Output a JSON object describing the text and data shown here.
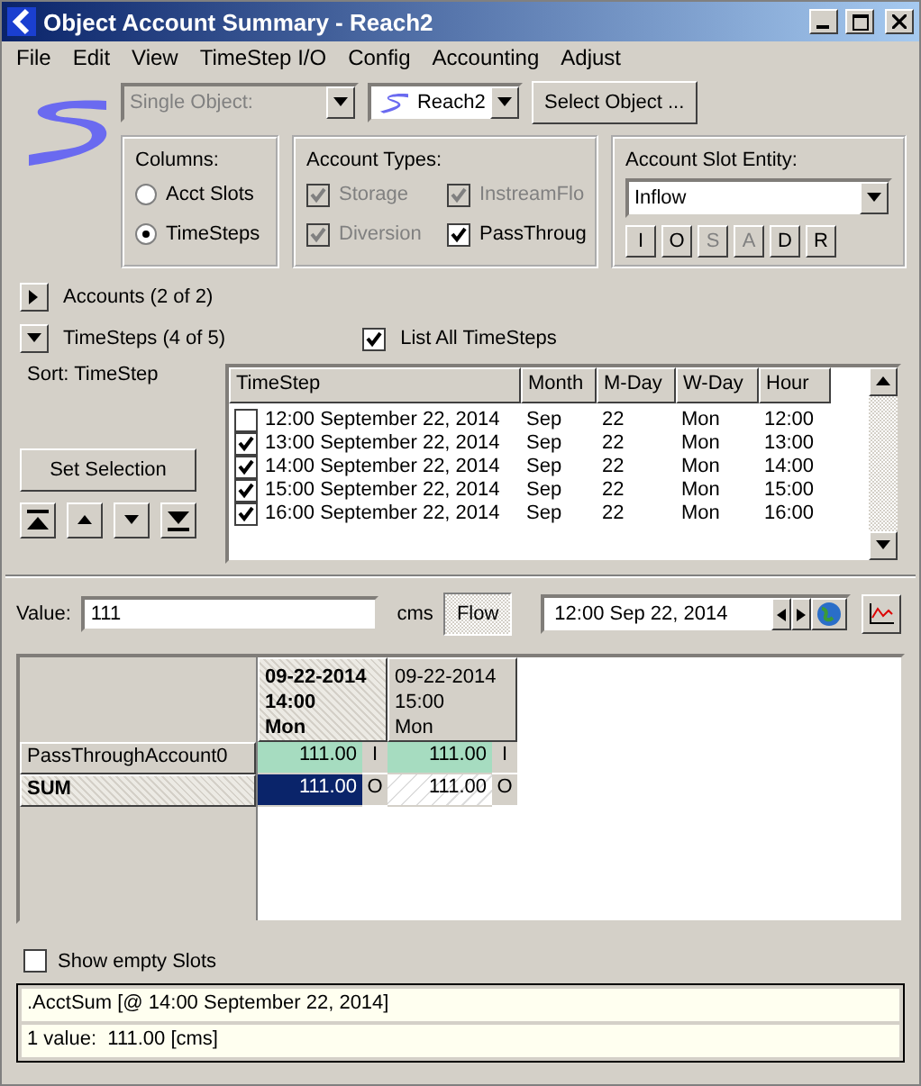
{
  "window": {
    "title": "Object Account Summary - Reach2"
  },
  "menu": [
    "File",
    "Edit",
    "View",
    "TimeStep I/O",
    "Config",
    "Accounting",
    "Adjust"
  ],
  "object_bar": {
    "mode": {
      "value": "Single Object:",
      "disabled": true
    },
    "object": "Reach2",
    "select_button": "Select Object ..."
  },
  "columns_group": {
    "title": "Columns:",
    "options": [
      {
        "label": "Acct Slots",
        "selected": false
      },
      {
        "label": "TimeSteps",
        "selected": true
      }
    ]
  },
  "account_types": {
    "title": "Account Types:",
    "items": [
      {
        "label": "Storage",
        "checked": true,
        "disabled": true
      },
      {
        "label": "InstreamFlo",
        "checked": true,
        "disabled": true
      },
      {
        "label": "Diversion",
        "checked": true,
        "disabled": true
      },
      {
        "label": "PassThroug",
        "checked": true,
        "disabled": false
      }
    ]
  },
  "slot_entity": {
    "title": "Account Slot Entity:",
    "value": "Inflow",
    "buttons": [
      {
        "label": "I",
        "disabled": false
      },
      {
        "label": "O",
        "disabled": false
      },
      {
        "label": "S",
        "disabled": true
      },
      {
        "label": "A",
        "disabled": true
      },
      {
        "label": "D",
        "disabled": false
      },
      {
        "label": "R",
        "disabled": false
      }
    ]
  },
  "accounts_toggle": {
    "label": "Accounts (2 of 2)",
    "expanded": false
  },
  "timesteps_toggle": {
    "label": "TimeSteps (4 of 5)",
    "expanded": true
  },
  "list_all": {
    "label": "List All TimeSteps",
    "checked": true
  },
  "sort_label": "Sort: TimeStep",
  "set_selection_button": "Set Selection",
  "timestep_table": {
    "columns": [
      "TimeStep",
      "Month",
      "M-Day",
      "W-Day",
      "Hour"
    ],
    "rows": [
      {
        "checked": false,
        "cells": [
          "12:00 September 22, 2014",
          "Sep",
          "22",
          "Mon",
          "12:00"
        ]
      },
      {
        "checked": true,
        "cells": [
          "13:00 September 22, 2014",
          "Sep",
          "22",
          "Mon",
          "13:00"
        ]
      },
      {
        "checked": true,
        "cells": [
          "14:00 September 22, 2014",
          "Sep",
          "22",
          "Mon",
          "14:00"
        ]
      },
      {
        "checked": true,
        "cells": [
          "15:00 September 22, 2014",
          "Sep",
          "22",
          "Mon",
          "15:00"
        ]
      },
      {
        "checked": true,
        "cells": [
          "16:00 September 22, 2014",
          "Sep",
          "22",
          "Mon",
          "16:00"
        ]
      }
    ]
  },
  "value_bar": {
    "label": "Value:",
    "value": "111",
    "unit": "cms",
    "flow_button": "Flow",
    "date": "12:00 Sep 22, 2014"
  },
  "grid": {
    "columns": [
      {
        "lines": [
          "09-22-2014",
          "14:00",
          "Mon"
        ],
        "selected": true
      },
      {
        "lines": [
          "09-22-2014",
          "15:00",
          "Mon"
        ],
        "selected": false
      }
    ],
    "rows": [
      {
        "label": "PassThroughAccount0",
        "kind": "account",
        "cells": [
          {
            "value": "111.00",
            "flag": "I",
            "selected": false
          },
          {
            "value": "111.00",
            "flag": "I",
            "selected": false
          }
        ]
      },
      {
        "label": "SUM",
        "kind": "sum",
        "cells": [
          {
            "value": "111.00",
            "flag": "O",
            "selected": true
          },
          {
            "value": "111.00",
            "flag": "O",
            "selected": false
          }
        ]
      }
    ]
  },
  "show_empty": {
    "label": "Show empty Slots",
    "checked": false
  },
  "status": [
    ".AcctSum [@ 14:00 September 22, 2014]",
    "1 value:  111.00 [cms]"
  ]
}
